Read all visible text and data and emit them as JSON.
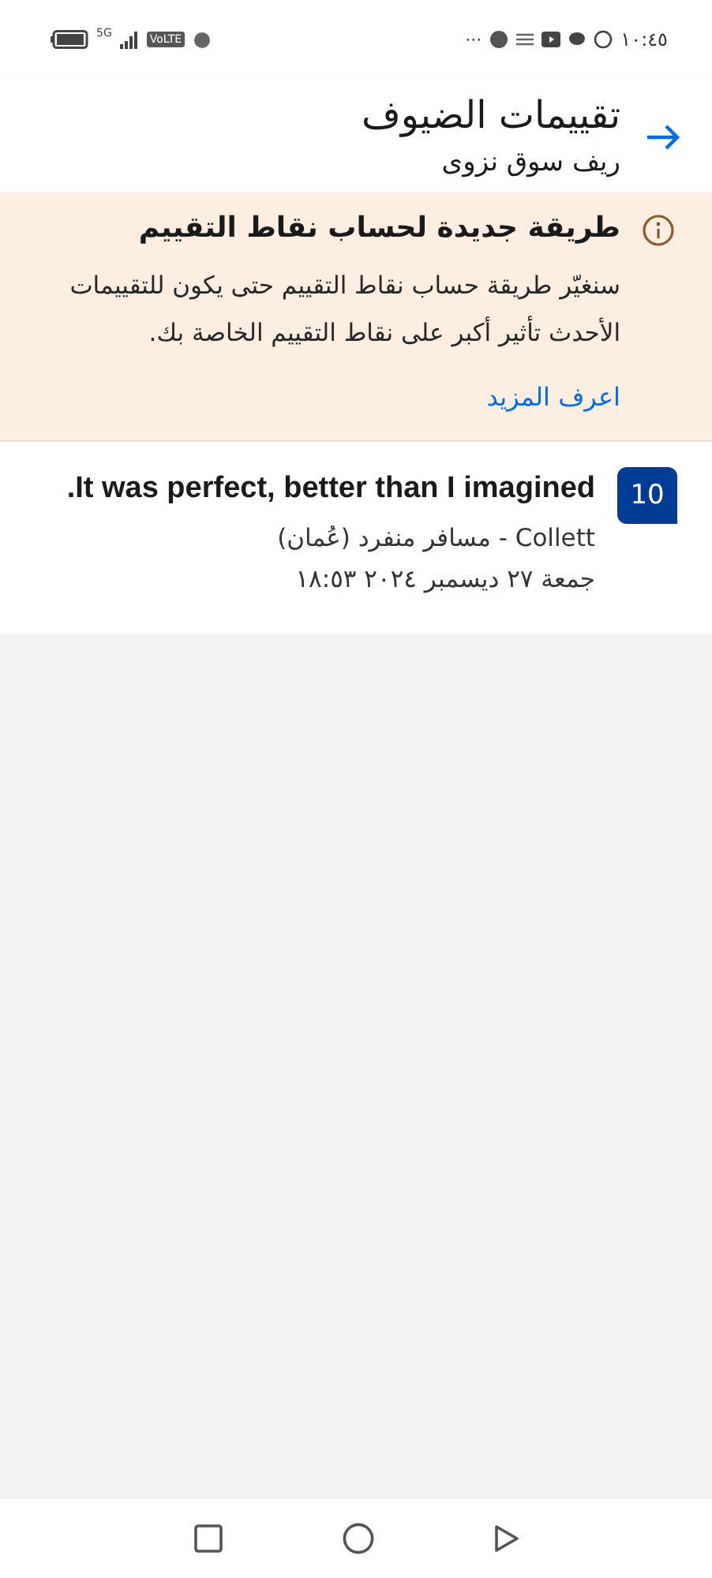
{
  "status_bar": {
    "time": "١٠:٤٥",
    "more": "···",
    "network": "5G",
    "volte": "VoLTE"
  },
  "header": {
    "title": "تقييمات الضيوف",
    "subtitle": "ريف سوق نزوى"
  },
  "notice": {
    "title": "طريقة جديدة لحساب نقاط التقييم",
    "body": "سنغيّر طريقة حساب نقاط التقييم حتى يكون للتقييمات الأحدث تأثير أكبر على نقاط التقييم الخاصة بك.",
    "link": "اعرف المزيد"
  },
  "reviews": [
    {
      "score": "10",
      "title": "It was perfect, better than I imagined.",
      "author": "Collett - مسافر منفرد (عُمان)",
      "date": "جمعة ٢٧ ديسمبر ٢٠٢٤ ١٨:٥٣"
    }
  ]
}
